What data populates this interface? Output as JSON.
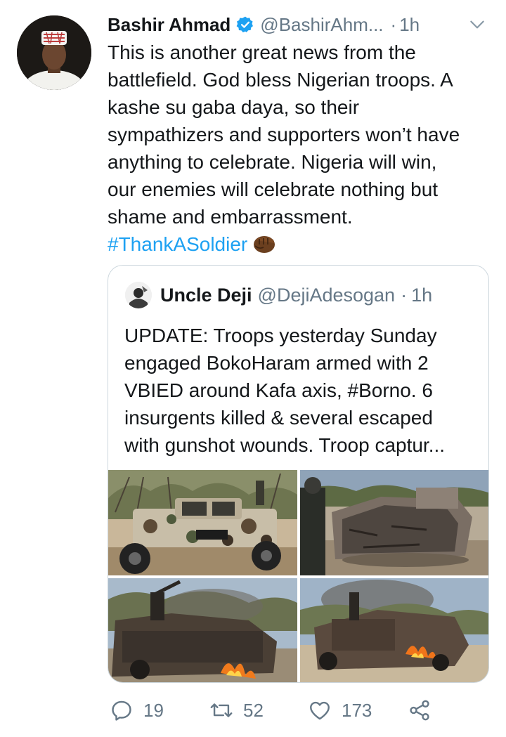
{
  "tweet": {
    "author_name": "Bashir Ahmad",
    "author_handle": "@BashirAhm...",
    "separator": "·",
    "time": "1h",
    "text_lines": [
      "This is another great news from the",
      "battlefield. God bless Nigerian troops. A",
      "kashe su gaba daya, so their",
      "sympathizers and supporters won’t have",
      "anything to celebrate. Nigeria will win,",
      "our enemies will celebrate nothing but",
      "shame and embarrassment."
    ],
    "hashtag": "#ThankASoldier",
    "emoji_icon": "fist-bump-icon",
    "verified_icon": "verified-badge-icon",
    "menu_icon": "chevron-down-icon"
  },
  "quoted_tweet": {
    "author_name": "Uncle Deji",
    "author_handle": "@DejiAdesogan",
    "separator": "·",
    "time": "1h",
    "text_lines": [
      "UPDATE: Troops yesterday Sunday",
      "engaged BokoHaram armed with 2",
      "VBIED around Kafa axis, #Borno. 6",
      "insurgents killed & several escaped",
      "with gunshot wounds. Troop captur..."
    ],
    "photos": [
      "camouflaged-truck-photo",
      "burnt-armored-vehicle-photo",
      "burning-gun-truck-photo",
      "burning-vehicle-photo"
    ]
  },
  "actions": {
    "reply_count": "19",
    "retweet_count": "52",
    "like_count": "173",
    "share_icon": "share-icon"
  },
  "colors": {
    "link": "#1da1f2",
    "secondary_text": "#657786",
    "primary_text": "#14171a",
    "border": "#ccd6dd"
  }
}
